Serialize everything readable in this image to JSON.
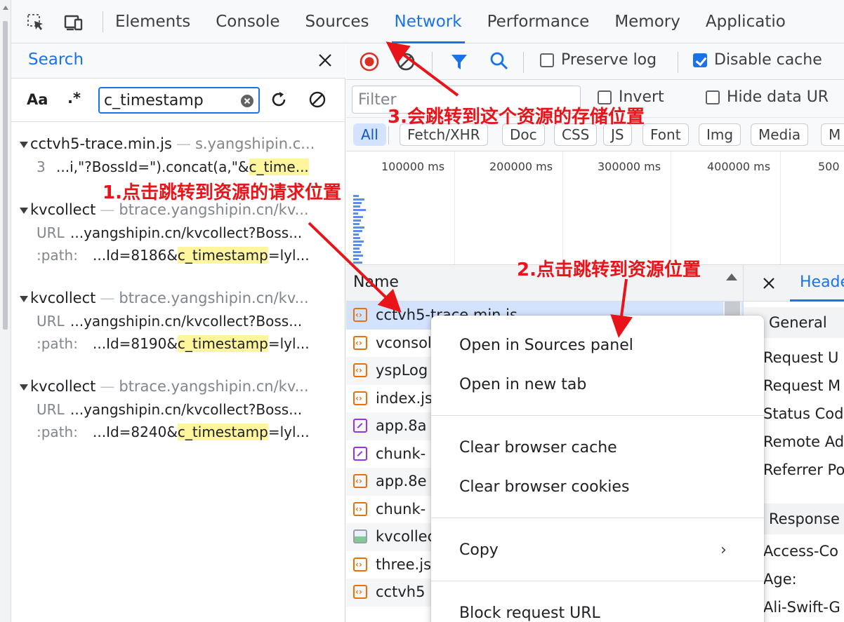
{
  "main_tabs": [
    {
      "label": "Elements",
      "active": false
    },
    {
      "label": "Console",
      "active": false
    },
    {
      "label": "Sources",
      "active": false
    },
    {
      "label": "Network",
      "active": true
    },
    {
      "label": "Performance",
      "active": false
    },
    {
      "label": "Memory",
      "active": false
    },
    {
      "label": "Applicatio",
      "active": false
    }
  ],
  "search": {
    "title": "Search",
    "case_toggle": "Aa",
    "regex_toggle": ".*",
    "query": "c_timestamp",
    "results": [
      {
        "file": "cctvh5-trace.min.js",
        "origin": "s.yangshipin.c...",
        "matches": [
          {
            "label": "3",
            "before": "...i,\"?BossId=\").concat(a,\"&",
            "highlight": "c_time...",
            "after": ""
          }
        ]
      },
      {
        "file": "kvcollect",
        "origin": "btrace.yangshipin.cn/kv...",
        "matches": [
          {
            "label": "URL",
            "before": "...yangshipin.cn/kvcollect?Boss...",
            "highlight": "",
            "after": ""
          },
          {
            "label": ":path:",
            "before": "...Id=8186&",
            "highlight": "c_timestamp",
            "after": "=lyl..."
          }
        ]
      },
      {
        "file": "kvcollect",
        "origin": "btrace.yangshipin.cn/kv...",
        "matches": [
          {
            "label": "URL",
            "before": "...yangshipin.cn/kvcollect?Boss...",
            "highlight": "",
            "after": ""
          },
          {
            "label": ":path:",
            "before": "...Id=8190&",
            "highlight": "c_timestamp",
            "after": "=lyl..."
          }
        ]
      },
      {
        "file": "kvcollect",
        "origin": "btrace.yangshipin.cn/kv...",
        "matches": [
          {
            "label": "URL",
            "before": "...yangshipin.cn/kvcollect?Boss...",
            "highlight": "",
            "after": ""
          },
          {
            "label": ":path:",
            "before": "...Id=8240&",
            "highlight": "c_timestamp",
            "after": "=lyl..."
          }
        ]
      }
    ]
  },
  "network": {
    "preserve_log": {
      "label": "Preserve log",
      "checked": false
    },
    "disable_cache": {
      "label": "Disable cache",
      "checked": true
    },
    "filter_placeholder": "Filter",
    "invert": {
      "label": "Invert",
      "checked": false
    },
    "hide_data_urls": {
      "label": "Hide data UR",
      "checked": false
    },
    "type_filters": [
      "All",
      "Fetch/XHR",
      "Doc",
      "CSS",
      "JS",
      "Font",
      "Img",
      "Media",
      "M"
    ],
    "active_type": "All",
    "timeline_ticks": [
      "100000 ms",
      "200000 ms",
      "300000 ms",
      "400000 ms",
      "500"
    ],
    "name_column": "Name",
    "requests": [
      {
        "name": "cctvh5-trace.min.js",
        "type": "js"
      },
      {
        "name": "vconsole",
        "type": "js"
      },
      {
        "name": "yspLog",
        "type": "js"
      },
      {
        "name": "index.js",
        "type": "js"
      },
      {
        "name": "app.8a",
        "type": "css"
      },
      {
        "name": "chunk-",
        "type": "css"
      },
      {
        "name": "app.8e",
        "type": "js"
      },
      {
        "name": "chunk-",
        "type": "js"
      },
      {
        "name": "kvcollect",
        "type": "img"
      },
      {
        "name": "three.js",
        "type": "js"
      },
      {
        "name": "cctvh5",
        "type": "js"
      }
    ]
  },
  "detail": {
    "tab": "Headers",
    "general": "General",
    "general_rows": [
      "Request U",
      "Request M",
      "Status Cod",
      "Remote Ad",
      "Referrer Po"
    ],
    "response_headers": "Response",
    "response_rows": [
      "Access-Co",
      "Age:",
      "Ali-Swift-G"
    ]
  },
  "context_menu": {
    "open_in_sources": "Open in Sources panel",
    "open_new_tab": "Open in new tab",
    "clear_cache": "Clear browser cache",
    "clear_cookies": "Clear browser cookies",
    "copy": "Copy",
    "block_url": "Block request URL"
  },
  "annotations": {
    "step1": "1.点击跳转到资源的请求位置",
    "step2": "2.点击跳转到资源位置",
    "step3": "3.会跳转到这个资源的存储位置"
  },
  "colors": {
    "accent": "#1a73e8",
    "annotation": "#e8141a",
    "highlight": "#fff59d",
    "selected_row": "#d3e3fd"
  }
}
